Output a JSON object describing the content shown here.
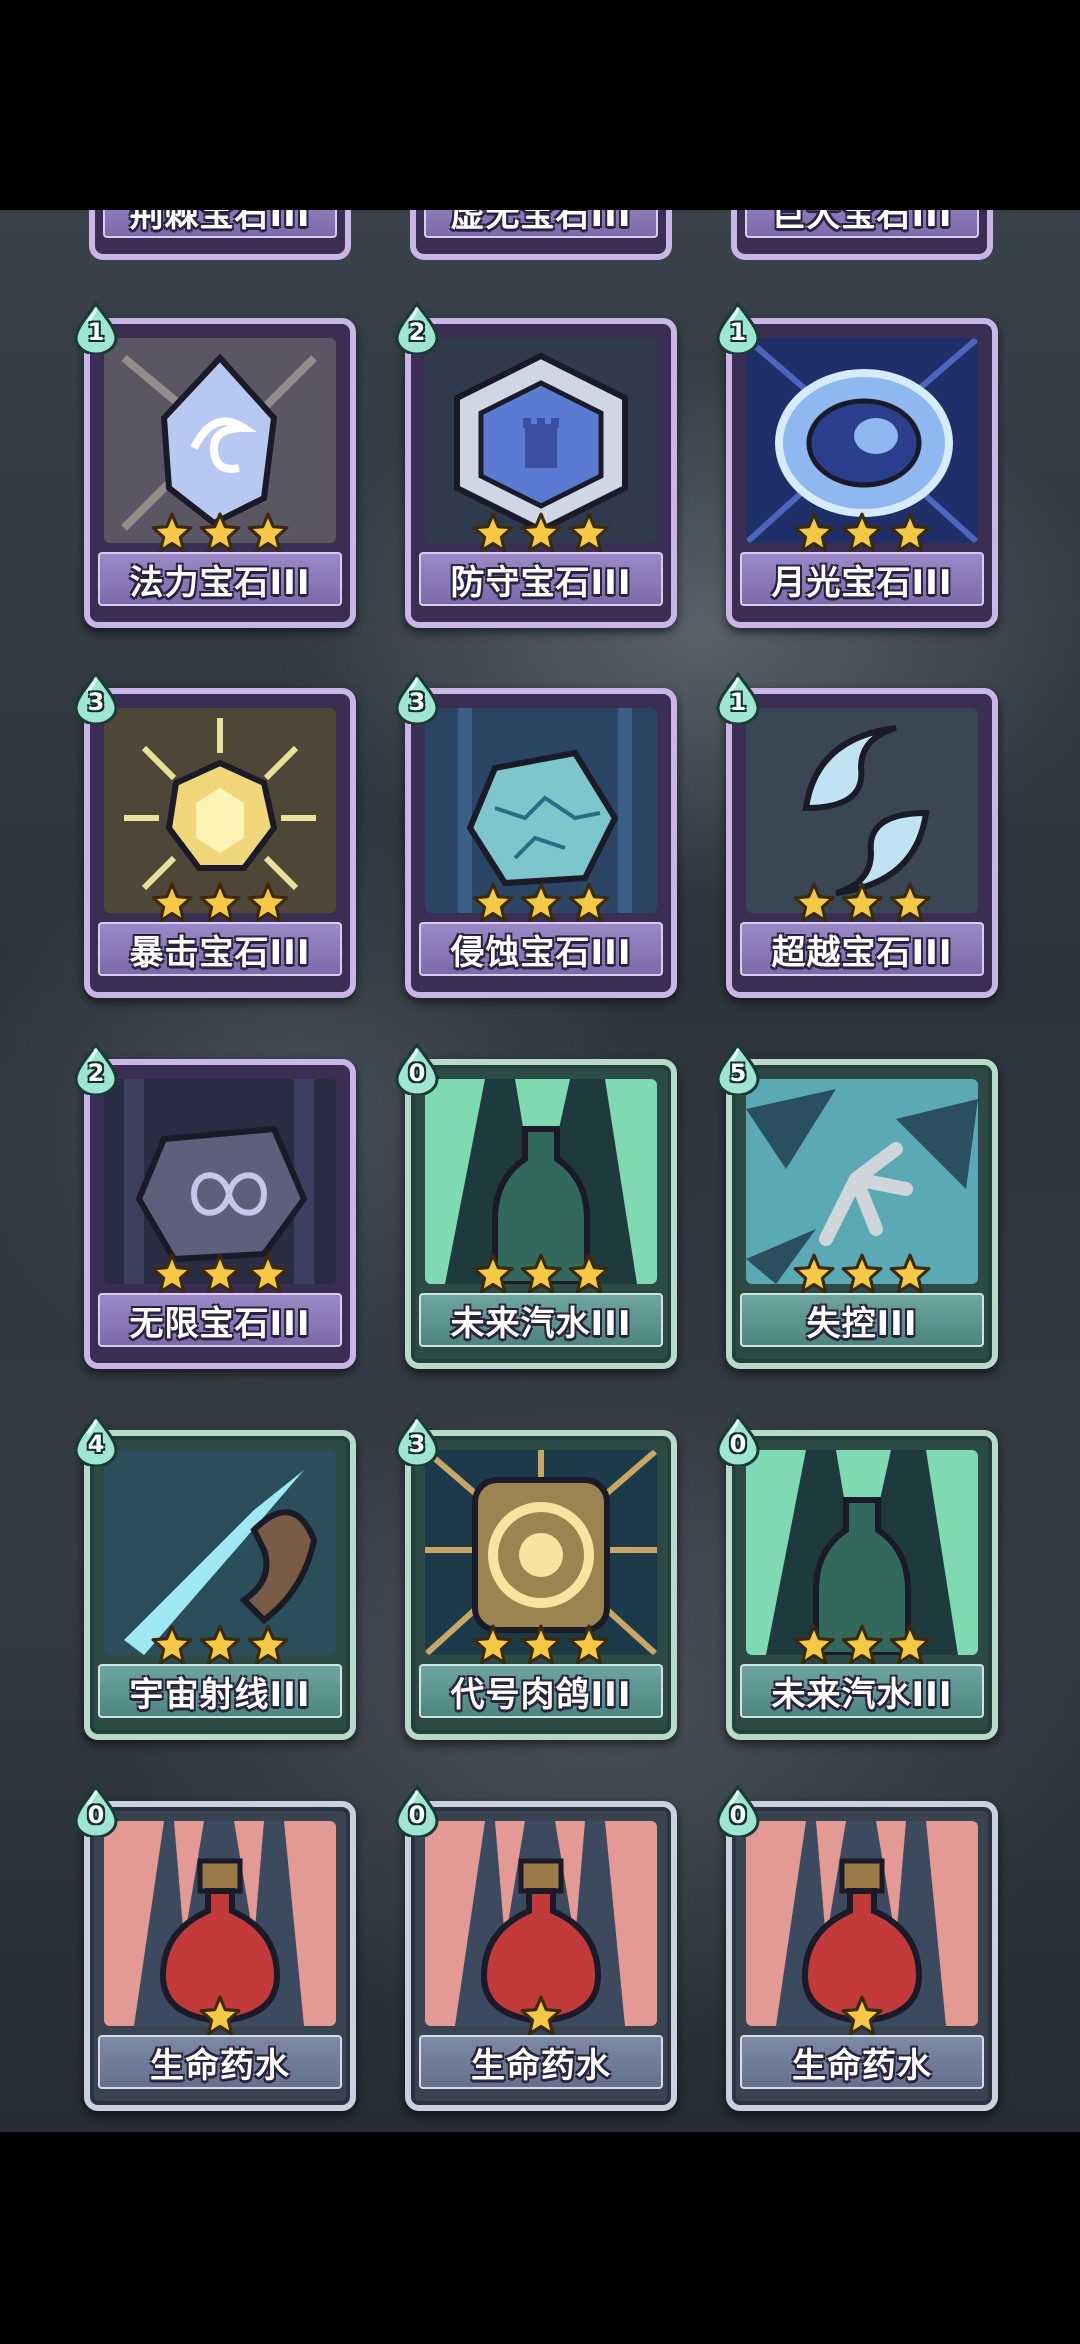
{
  "partial_row": [
    {
      "name": "荆棘宝石III"
    },
    {
      "name": "虚无宝石III"
    },
    {
      "name": "巨大宝石III"
    }
  ],
  "cards": [
    {
      "cost": "1",
      "name": "法力宝石III",
      "stars": 3,
      "theme": "purple",
      "icon": "mana-gem-icon"
    },
    {
      "cost": "2",
      "name": "防守宝石III",
      "stars": 3,
      "theme": "purple",
      "icon": "defense-gem-icon"
    },
    {
      "cost": "1",
      "name": "月光宝石III",
      "stars": 3,
      "theme": "purple",
      "icon": "moonlight-gem-icon"
    },
    {
      "cost": "3",
      "name": "暴击宝石III",
      "stars": 3,
      "theme": "purple",
      "icon": "crit-gem-icon"
    },
    {
      "cost": "3",
      "name": "侵蚀宝石III",
      "stars": 3,
      "theme": "purple",
      "icon": "erosion-gem-icon"
    },
    {
      "cost": "1",
      "name": "超越宝石III",
      "stars": 3,
      "theme": "purple",
      "icon": "transcend-gem-icon"
    },
    {
      "cost": "2",
      "name": "无限宝石III",
      "stars": 3,
      "theme": "purple",
      "icon": "infinity-gem-icon"
    },
    {
      "cost": "0",
      "name": "未来汽水III",
      "stars": 3,
      "theme": "teal",
      "icon": "future-soda-icon"
    },
    {
      "cost": "5",
      "name": "失控III",
      "stars": 3,
      "theme": "teal",
      "icon": "out-of-control-icon"
    },
    {
      "cost": "4",
      "name": "宇宙射线III",
      "stars": 3,
      "theme": "teal",
      "icon": "cosmic-ray-icon"
    },
    {
      "cost": "3",
      "name": "代号肉鸽III",
      "stars": 3,
      "theme": "teal",
      "icon": "codename-roguelike-icon"
    },
    {
      "cost": "0",
      "name": "未来汽水III",
      "stars": 3,
      "theme": "teal",
      "icon": "future-soda-icon"
    },
    {
      "cost": "0",
      "name": "生命药水",
      "stars": 1,
      "theme": "blue",
      "icon": "health-potion-icon"
    },
    {
      "cost": "0",
      "name": "生命药水",
      "stars": 1,
      "theme": "blue",
      "icon": "health-potion-icon"
    },
    {
      "cost": "0",
      "name": "生命药水",
      "stars": 1,
      "theme": "blue",
      "icon": "health-potion-icon"
    }
  ]
}
